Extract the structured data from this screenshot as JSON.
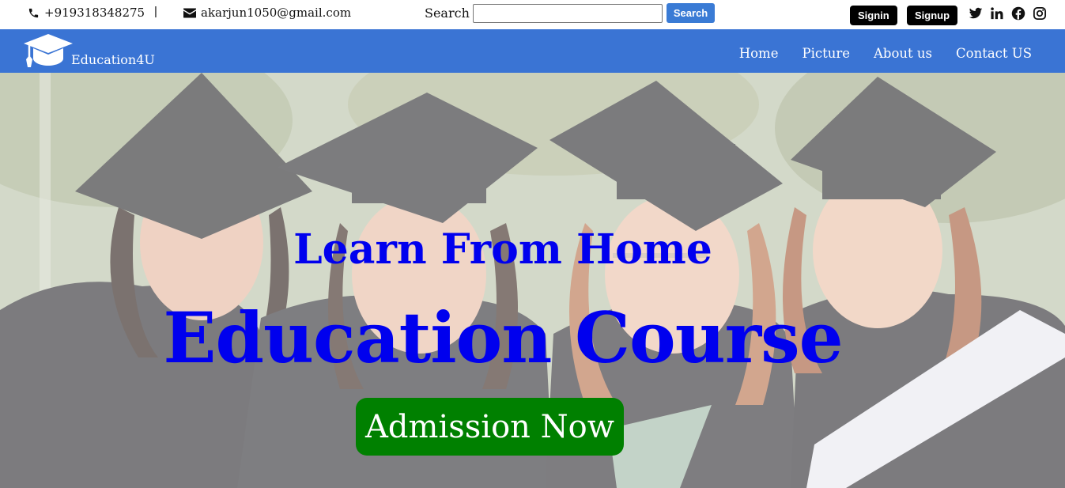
{
  "topbar": {
    "phone": "+919318348275",
    "separator": "|",
    "email": "akarjun1050@gmail.com",
    "search_label": "Search",
    "search_placeholder": "",
    "search_button": "Search",
    "signin": "Signin",
    "signup": "Signup",
    "social_icons": [
      "twitter-icon",
      "linkedin-icon",
      "facebook-icon",
      "instagram-icon"
    ]
  },
  "nav": {
    "brand": "Education4U",
    "logo_icon": "graduation-cap-icon",
    "links": [
      "Home",
      "Picture",
      "About us",
      "Contact US"
    ]
  },
  "hero": {
    "subtitle": "Learn From Home",
    "title": "Education Course",
    "cta": "Admission Now"
  },
  "colors": {
    "nav_bg": "#3a74d4",
    "search_button": "#3a7bd5",
    "auth_button": "#000000",
    "hero_text": "#0000ee",
    "cta_bg": "#008000"
  }
}
